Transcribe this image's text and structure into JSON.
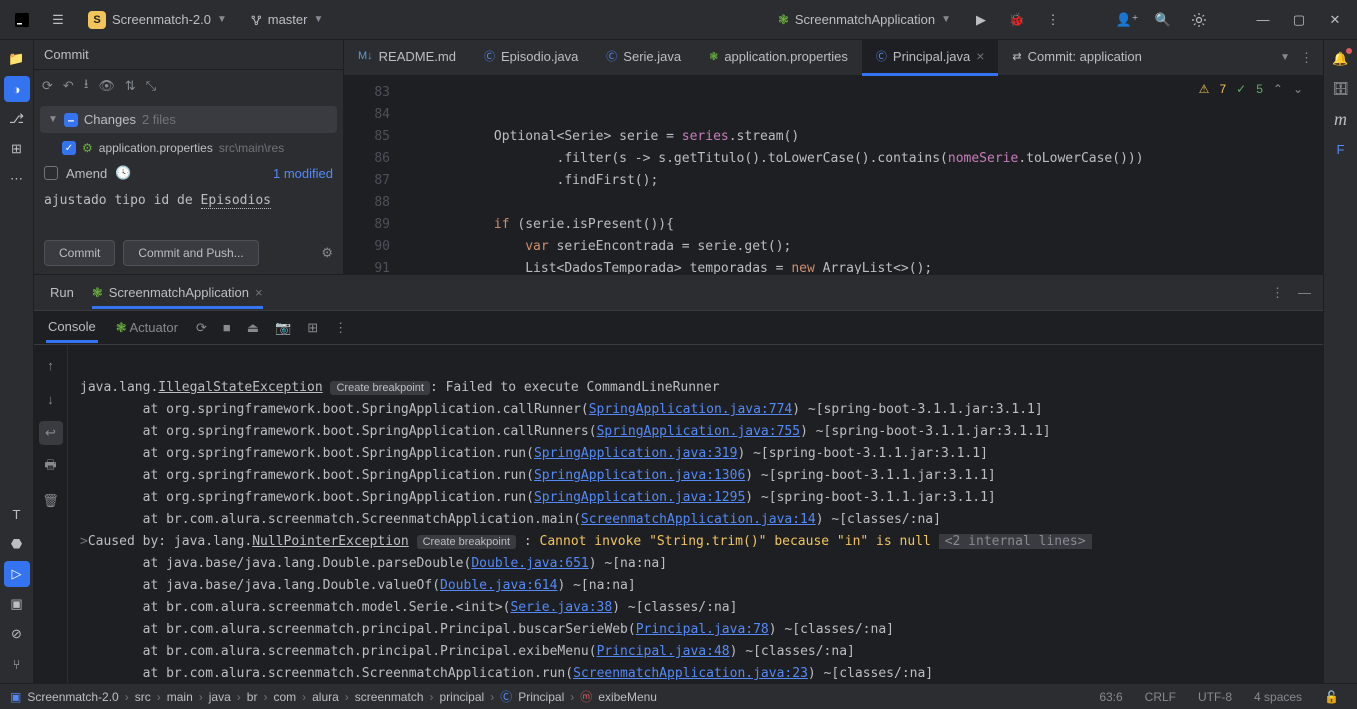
{
  "topbar": {
    "project_initial": "S",
    "project_name": "Screenmatch-2.0",
    "branch": "master",
    "run_config": "ScreenmatchApplication"
  },
  "commit": {
    "title": "Commit",
    "changes_label": "Changes",
    "changes_count": "2 files",
    "file_name": "application.properties",
    "file_path": "src\\main\\res",
    "amend_label": "Amend",
    "modified_label": "1 modified",
    "message_prefix": "ajustado tipo id de ",
    "message_hl": "Episodios",
    "commit_btn": "Commit",
    "commit_push_btn": "Commit and Push..."
  },
  "tabs": {
    "t0": "README.md",
    "t1": "Episodio.java",
    "t2": "Serie.java",
    "t3": "application.properties",
    "t4": "Principal.java",
    "t5": "Commit: application"
  },
  "editor": {
    "warn": "7",
    "ok": "5",
    "lines": {
      "l83": "83",
      "l84": "84",
      "l85": "85",
      "l86": "86",
      "l87": "87",
      "l88": "88",
      "l89": "89",
      "l90": "90",
      "l91": "91"
    }
  },
  "run": {
    "label": "Run",
    "app": "ScreenmatchApplication",
    "console_tab": "Console",
    "actuator_tab": "Actuator"
  },
  "console": {
    "exc1": "IllegalStateException",
    "bp": "Create breakpoint",
    "exc1_msg": ": Failed to execute CommandLineRunner",
    "st1_pre": "        at org.springframework.boot.SpringApplication.callRunner(",
    "st1_link": "SpringApplication.java:774",
    "st1_post": ") ~[spring-boot-3.1.1.jar:3.1.1]",
    "st2_pre": "        at org.springframework.boot.SpringApplication.callRunners(",
    "st2_link": "SpringApplication.java:755",
    "st2_post": ") ~[spring-boot-3.1.1.jar:3.1.1]",
    "st3_pre": "        at org.springframework.boot.SpringApplication.run(",
    "st3_link": "SpringApplication.java:319",
    "st3_post": ") ~[spring-boot-3.1.1.jar:3.1.1]",
    "st4_pre": "        at org.springframework.boot.SpringApplication.run(",
    "st4_link": "SpringApplication.java:1306",
    "st4_post": ") ~[spring-boot-3.1.1.jar:3.1.1]",
    "st5_pre": "        at org.springframework.boot.SpringApplication.run(",
    "st5_link": "SpringApplication.java:1295",
    "st5_post": ") ~[spring-boot-3.1.1.jar:3.1.1]",
    "st6_pre": "        at br.com.alura.screenmatch.ScreenmatchApplication.main(",
    "st6_link": "ScreenmatchApplication.java:14",
    "st6_post": ") ~[classes/:na]",
    "caused_pre": "Caused by: java.lang.",
    "exc2": "NullPointerException",
    "caused_msg": "Cannot invoke \"String.trim()\" because \"in\" is null",
    "internal": "<2 internal lines>",
    "st7_pre": "        at java.base/java.lang.Double.parseDouble(",
    "st7_link": "Double.java:651",
    "st7_post": ") ~[na:na]",
    "st8_pre": "        at java.base/java.lang.Double.valueOf(",
    "st8_link": "Double.java:614",
    "st8_post": ") ~[na:na]",
    "st9_pre": "        at br.com.alura.screenmatch.model.Serie.<init>(",
    "st9_link": "Serie.java:38",
    "st9_post": ") ~[classes/:na]",
    "st10_pre": "        at br.com.alura.screenmatch.principal.Principal.buscarSerieWeb(",
    "st10_link": "Principal.java:78",
    "st10_post": ") ~[classes/:na]",
    "st11_pre": "        at br.com.alura.screenmatch.principal.Principal.exibeMenu(",
    "st11_link": "Principal.java:48",
    "st11_post": ") ~[classes/:na]",
    "st12_pre": "        at br.com.alura.screenmatch.ScreenmatchApplication.run(",
    "st12_link": "ScreenmatchApplication.java:23",
    "st12_post": ") ~[classes/:na]"
  },
  "status": {
    "c0": "Screenmatch-2.0",
    "c1": "src",
    "c2": "main",
    "c3": "java",
    "c4": "br",
    "c5": "com",
    "c6": "alura",
    "c7": "screenmatch",
    "c8": "principal",
    "c9": "Principal",
    "c10": "exibeMenu",
    "pos": "63:6",
    "eol": "CRLF",
    "enc": "UTF-8",
    "indent": "4 spaces"
  }
}
